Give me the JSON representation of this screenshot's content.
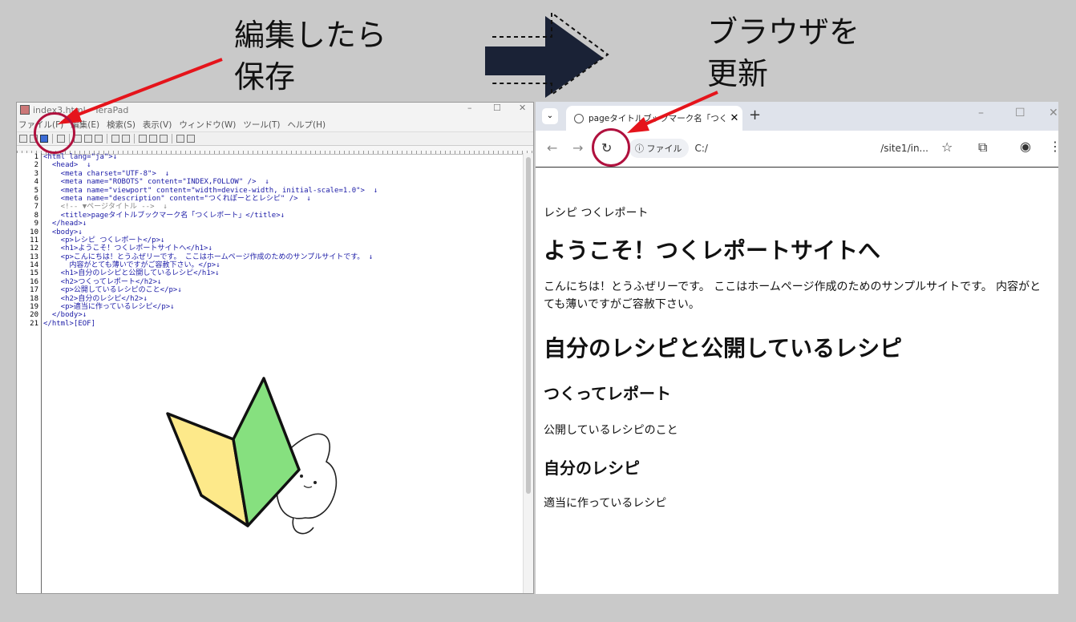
{
  "callouts": {
    "save_line1": "編集したら",
    "save_line2": "保存",
    "refresh_line1": "ブラウザを",
    "refresh_line2": "更新"
  },
  "editor": {
    "title": "index3.html - TeraPad",
    "min": "–",
    "max": "☐",
    "close": "✕",
    "menu": [
      "ファイル(F)",
      "編集(E)",
      "検索(S)",
      "表示(V)",
      "ウィンドウ(W)",
      "ツール(T)",
      "ヘルプ(H)"
    ],
    "line_numbers": [
      "1",
      "2",
      "3",
      "4",
      "5",
      "6",
      "7",
      "8",
      "9",
      "10",
      "11",
      "12",
      "13",
      "14",
      "15",
      "16",
      "17",
      "18",
      "19",
      "20",
      "21"
    ],
    "code": {
      "l1": "<html lang=\"ja\">↓",
      "l2": "  <head>  ↓",
      "l3": "    <meta charset=\"UTF-8\">  ↓",
      "l4": "    <meta name=\"ROBOTS\" content=\"INDEX,FOLLOW\" />  ↓",
      "l5": "    <meta name=\"viewport\" content=\"width=device-width, initial-scale=1.0\">  ↓",
      "l6": "    <meta name=\"description\" content=\"つくれぽーととレシピ\" />  ↓",
      "l7": "    <!-- ▼ページタイトル -->  ↓",
      "l8": "    <title>pageタイトルブックマーク名「つくレポート」</title>↓",
      "l9": "  </head>↓",
      "l10": "  <body>↓",
      "l11": "    <p>レシピ つくレポート</p>↓",
      "l12": "    <h1>ようこそ！つくレポートサイトへ</h1>↓",
      "l13": "    <p>こんにちは！とうふぜリーです。 ここはホームページ作成のためのサンプルサイトです。 ↓",
      "l14": "      内容がとても薄いですがご容赦下さい。</p>↓",
      "l15": "    <h1>自分のレシピと公開しているレシピ</h1>↓",
      "l16": "    <h2>つくってレポート</h2>↓",
      "l17": "    <p>公開しているレシピのこと</p>↓",
      "l18": "    <h2>自分のレシピ</h2>↓",
      "l19": "    <p>適当に作っているレシピ</p>↓",
      "l20": "  </body>↓",
      "l21": "</html>[EOF]"
    }
  },
  "browser": {
    "tab_title": "pageタイトルブックマーク名「つくレポー",
    "tab_close": "✕",
    "new_tab": "+",
    "min": "–",
    "max": "☐",
    "close": "✕",
    "back": "←",
    "forward": "→",
    "reload": "↻",
    "omnibox_chip": "ⓘ ファイル",
    "url_start": "C:/",
    "url_end": "/site1/in...",
    "star": "☆",
    "extensions": "⧉",
    "profile": "◉",
    "more": "⋮",
    "content": {
      "p1": "レシピ つくレポート",
      "h1a": "ようこそ！つくレポートサイトへ",
      "p2": "こんにちは！とうふぜリーです。 ここはホームページ作成のためのサンプルサイトです。 内容がとても薄いですがご容赦下さい。",
      "h1b": "自分のレシピと公開しているレシピ",
      "h2a": "つくってレポート",
      "p3": "公開しているレシピのこと",
      "h2b": "自分のレシピ",
      "p4": "適当に作っているレシピ"
    }
  },
  "colors": {
    "arrow_red": "#e5141b",
    "circle": "#b0113e",
    "big_arrow": "#1a2236",
    "badge_yellow": "#fde98a",
    "badge_green": "#86e07f"
  }
}
